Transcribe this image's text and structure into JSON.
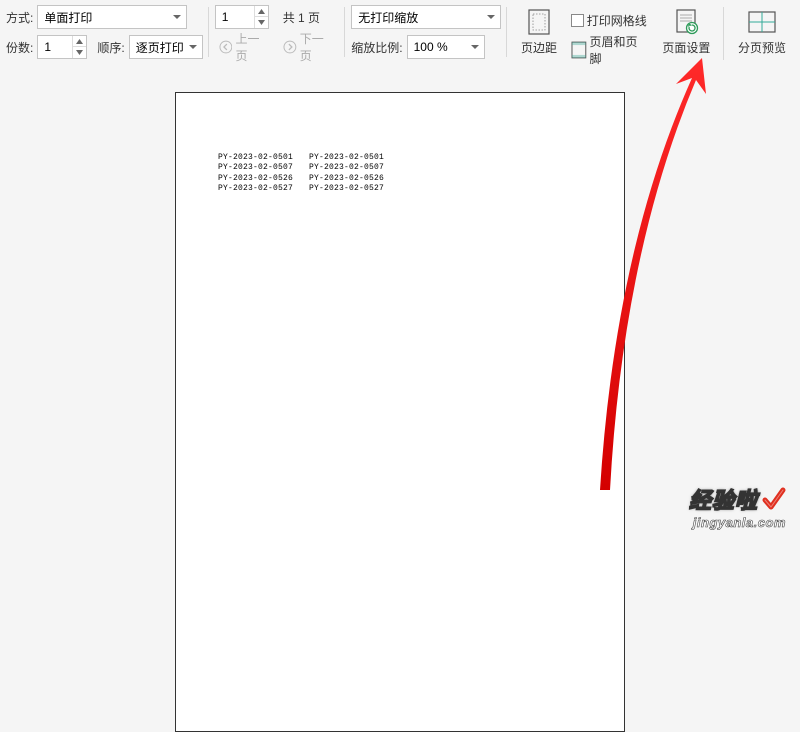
{
  "toolbar": {
    "mode_label": "方式:",
    "mode_value": "单面打印",
    "copies_label": "份数:",
    "copies_value": "1",
    "order_label": "顺序:",
    "order_value": "逐页打印",
    "page_num": "1",
    "page_total": "共 1 页",
    "prev_page": "上一页",
    "next_page": "下一页",
    "scale_mode": "无打印缩放",
    "scale_label": "缩放比例:",
    "scale_value": "100 %",
    "margins": "页边距",
    "gridlines": "打印网格线",
    "header_footer": "页眉和页脚",
    "page_setup": "页面设置",
    "split_preview": "分页预览"
  },
  "document": {
    "columns": [
      [
        "PY-2023-02-0501",
        "PY-2023-02-0507",
        "PY-2023-02-0526",
        "PY-2023-02-0527"
      ],
      [
        "PY-2023-02-0501",
        "PY-2023-02-0507",
        "PY-2023-02-0526",
        "PY-2023-02-0527"
      ]
    ]
  },
  "watermark": {
    "text": "经验啦",
    "url": "jingyanla.com"
  }
}
